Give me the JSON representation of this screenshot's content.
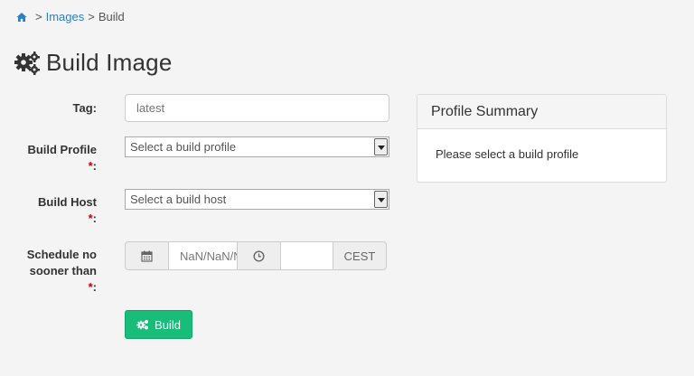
{
  "breadcrumb": {
    "home_icon": "home-icon",
    "items": [
      "Images",
      "Build"
    ],
    "separator": ">"
  },
  "page": {
    "title": "Build Image",
    "title_icon": "gears-icon"
  },
  "form": {
    "tag": {
      "label": "Tag:",
      "placeholder": "latest"
    },
    "build_profile": {
      "label": "Build Profile",
      "required_mark": "*",
      "suffix": ":",
      "selected": "Select a build profile"
    },
    "build_host": {
      "label": "Build Host",
      "required_mark": "*",
      "suffix": ":",
      "selected": "Select a build host"
    },
    "schedule": {
      "label_line1": "Schedule no",
      "label_line2": "sooner than",
      "required_mark": "*",
      "suffix": ":",
      "date_value": "NaN/NaN/NaN",
      "time_value": "",
      "timezone": "CEST"
    },
    "submit_label": "Build"
  },
  "profile_summary": {
    "title": "Profile Summary",
    "body": "Please select a build profile"
  },
  "colors": {
    "link": "#2b80c4",
    "build_button": "#1abc7a",
    "required": "#cc0000"
  }
}
